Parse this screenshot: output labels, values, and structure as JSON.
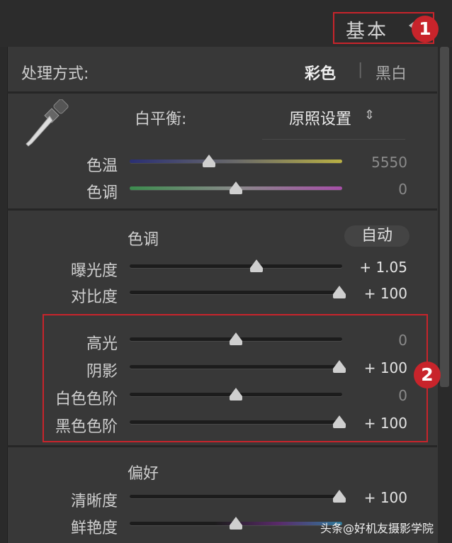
{
  "panel": {
    "title": "基本"
  },
  "callouts": {
    "one": "1",
    "two": "2"
  },
  "treatment": {
    "label": "处理方式:",
    "color_option": "彩色",
    "separator": "|",
    "bw_option": "黑白"
  },
  "white_balance": {
    "label": "白平衡:",
    "value": "原照设置",
    "arrows": "⇕"
  },
  "sliders": {
    "temp": {
      "label": "色温",
      "value": "5550",
      "level": 0.37,
      "gradient": "blue-yellow"
    },
    "tint": {
      "label": "色调",
      "value": "0",
      "level": 0.5,
      "gradient": "green-magenta"
    },
    "exposure": {
      "label": "曝光度",
      "value": "+ 1.05",
      "level": 0.6
    },
    "contrast": {
      "label": "对比度",
      "value": "+ 100",
      "level": 1.0
    },
    "highlights": {
      "label": "高光",
      "value": "0",
      "level": 0.5
    },
    "shadows": {
      "label": "阴影",
      "value": "+ 100",
      "level": 1.0
    },
    "whites": {
      "label": "白色色阶",
      "value": "0",
      "level": 0.5
    },
    "blacks": {
      "label": "黑色色阶",
      "value": "+ 100",
      "level": 1.0
    },
    "clarity": {
      "label": "清晰度",
      "value": "+ 100",
      "level": 1.0
    },
    "vibrance": {
      "label": "鲜艳度",
      "value": "",
      "level": 0.5
    }
  },
  "tone": {
    "label": "色调",
    "auto_label": "自动"
  },
  "presence": {
    "label": "偏好"
  },
  "watermark": "头条@好机友摄影学院",
  "colors": {
    "highlight_red": "#c8242b"
  }
}
